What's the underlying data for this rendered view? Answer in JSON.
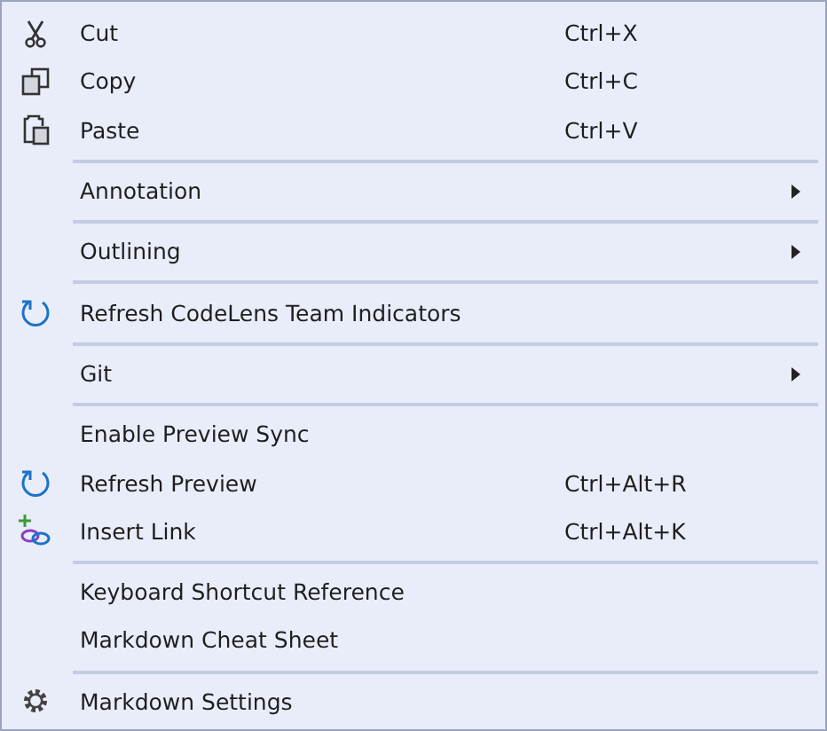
{
  "menu": {
    "groups": [
      {
        "items": [
          {
            "label": "Cut",
            "shortcut": "Ctrl+X",
            "kind": "scissors",
            "submenu": false
          },
          {
            "label": "Copy",
            "shortcut": "Ctrl+C",
            "kind": "copy",
            "submenu": false
          },
          {
            "label": "Paste",
            "shortcut": "Ctrl+V",
            "kind": "clipboard",
            "submenu": false
          }
        ]
      },
      {
        "items": [
          {
            "label": "Annotation",
            "submenu": true
          }
        ]
      },
      {
        "items": [
          {
            "label": "Outlining",
            "submenu": true
          }
        ]
      },
      {
        "items": [
          {
            "label": "Refresh CodeLens Team Indicators",
            "kind": "refresh",
            "submenu": false
          }
        ]
      },
      {
        "items": [
          {
            "label": "Git",
            "submenu": true
          }
        ]
      },
      {
        "items": [
          {
            "label": "Enable Preview Sync",
            "submenu": false
          },
          {
            "label": "Refresh Preview",
            "shortcut": "Ctrl+Alt+R",
            "kind": "refresh",
            "submenu": false
          },
          {
            "label": "Insert Link",
            "shortcut": "Ctrl+Alt+K",
            "kind": "link",
            "submenu": false
          }
        ]
      },
      {
        "items": [
          {
            "label": "Keyboard Shortcut Reference",
            "submenu": false
          },
          {
            "label": "Markdown Cheat Sheet",
            "submenu": false
          }
        ]
      },
      {
        "items": [
          {
            "label": "Markdown Settings",
            "kind": "gear",
            "submenu": false
          }
        ]
      }
    ]
  }
}
